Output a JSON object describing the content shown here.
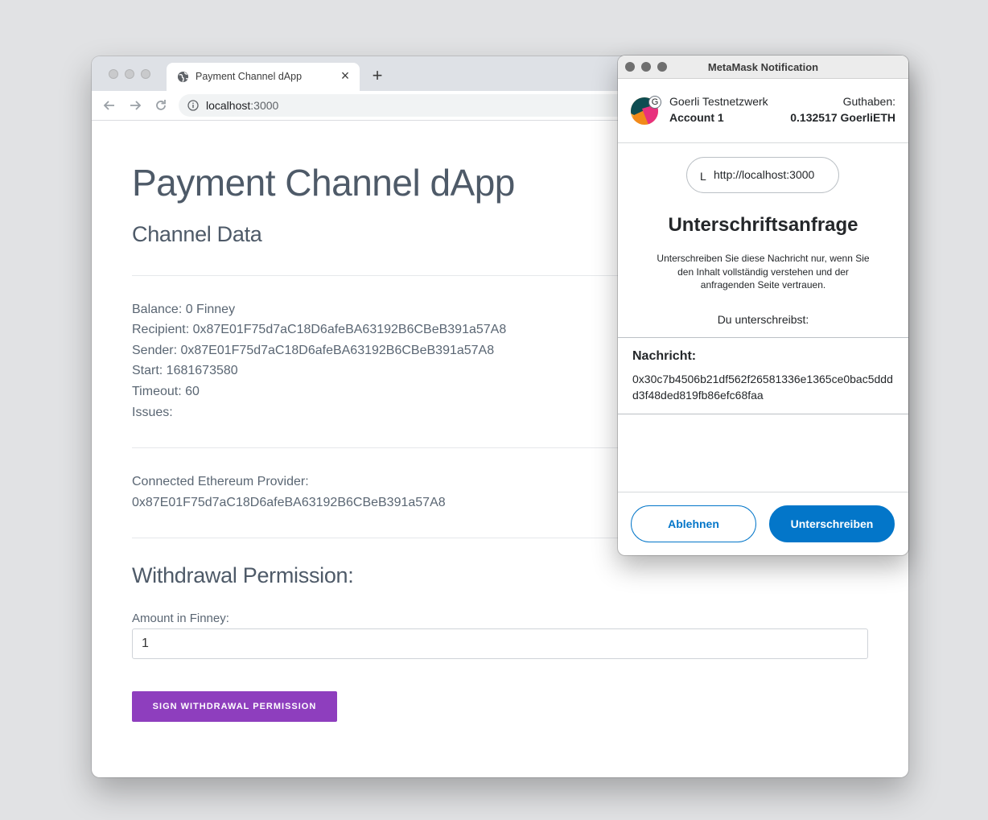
{
  "browser": {
    "tab_title": "Payment Channel dApp",
    "tab_close": "×",
    "new_tab": "+",
    "url_host": "localhost",
    "url_port": ":3000",
    "icons": {
      "back": "back-arrow-icon",
      "forward": "forward-arrow-icon",
      "reload": "reload-icon",
      "site_info": "info-icon",
      "tab_favicon": "globe-icon"
    }
  },
  "page": {
    "title": "Payment Channel dApp",
    "channel_heading": "Channel Data",
    "channel_lines": {
      "balance": "Balance: 0 Finney",
      "recipient": "Recipient: 0x87E01F75d7aC18D6afeBA63192B6CBeB391a57A8",
      "sender": "Sender: 0x87E01F75d7aC18D6afeBA63192B6CBeB391a57A8",
      "start": "Start: 1681673580",
      "timeout": "Timeout: 60",
      "issues": "Issues:"
    },
    "provider_label": "Connected Ethereum Provider:",
    "provider_address": "0x87E01F75d7aC18D6afeBA63192B6CBeB391a57A8",
    "withdrawal_heading": "Withdrawal Permission:",
    "amount_label": "Amount in Finney:",
    "amount_value": "1",
    "sign_button": "SIGN WITHDRAWAL PERMISSION",
    "accent_color": "#8e3ebe"
  },
  "metamask": {
    "window_title": "MetaMask Notification",
    "network": "Goerli Testnetzwerk",
    "network_badge": "G",
    "account": "Account 1",
    "balance_label": "Guthaben:",
    "balance_value": "0.132517 GoerliETH",
    "origin_icon": "L",
    "origin": "http://localhost:3000",
    "heading": "Unterschriftsanfrage",
    "description": "Unterschreiben Sie diese Nachricht nur, wenn Sie den Inhalt vollständig verstehen und der anfragenden Seite vertrauen.",
    "signing_label": "Du unterschreibst:",
    "message_label": "Nachricht:",
    "message": "0x30c7b4506b21df562f26581336e1365ce0bac5dddd3f48ded819fb86efc68faa",
    "reject_button": "Ablehnen",
    "sign_button": "Unterschreiben",
    "brand_color": "#0376c9"
  }
}
